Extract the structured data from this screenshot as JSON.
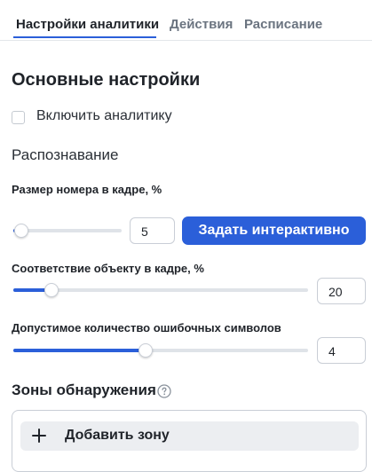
{
  "tabs": [
    {
      "label": "Настройки аналитики",
      "active": true
    },
    {
      "label": "Действия",
      "active": false
    },
    {
      "label": "Расписание",
      "active": false
    }
  ],
  "main": {
    "section_title": "Основные настройки",
    "enable_checkbox": {
      "label": "Включить аналитику",
      "checked": false
    },
    "subheading": "Распознавание",
    "plate_size": {
      "label": "Размер номера в кадре, %",
      "value": "5",
      "slider_fraction": 0.07,
      "button_label": "Задать интерактивно"
    },
    "object_match": {
      "label": "Соответствие объекту в кадре, %",
      "value": "20",
      "slider_fraction": 0.13
    },
    "error_chars": {
      "label": "Допустимое количество ошибочных символов",
      "value": "4",
      "slider_fraction": 0.45
    },
    "zones": {
      "title": "Зоны обнаружения",
      "help_icon": "help-circle-icon",
      "add_label": "Добавить зону",
      "add_icon": "plus-icon"
    }
  },
  "colors": {
    "accent": "#2b5fd9",
    "text": "#1f2329",
    "muted": "#6b7480",
    "track": "#dfe3e8"
  }
}
